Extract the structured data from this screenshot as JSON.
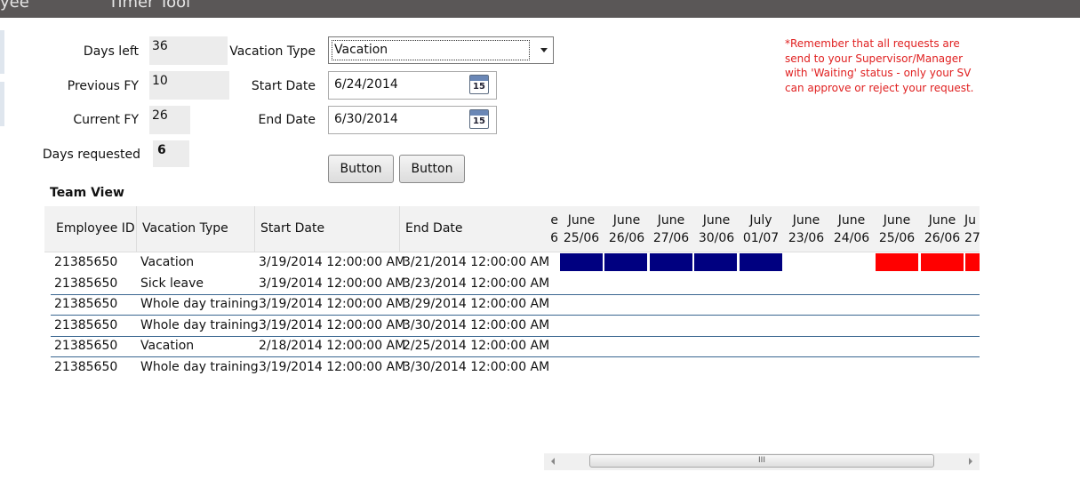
{
  "header": {
    "tab_left": "yee",
    "tab_center": "Timer Tool"
  },
  "form": {
    "days_left_label": "Days left",
    "days_left_value": "36",
    "previous_fy_label": "Previous FY",
    "previous_fy_value": "10",
    "current_fy_label": "Current FY",
    "current_fy_value": "26",
    "days_requested_label": "Days requested",
    "days_requested_value": "6",
    "vacation_type_label": "Vacation Type",
    "vacation_type_value": "Vacation",
    "start_date_label": "Start Date",
    "start_date_value": "6/24/2014",
    "end_date_label": "End Date",
    "end_date_value": "6/30/2014",
    "calendar_day": "15",
    "button1_label": "Button",
    "button2_label": "Button"
  },
  "note": "*Remember that all requests are send to your Supervisor/Manager with 'Waiting' status - only your SV can approve or reject your request.",
  "team_view": {
    "title": "Team View",
    "columns": [
      "Employee ID",
      "Vacation Type",
      "Start Date",
      "End Date"
    ],
    "day_columns": [
      {
        "month": "e",
        "day": "6"
      },
      {
        "month": "June",
        "day": "25/06"
      },
      {
        "month": "June",
        "day": "26/06"
      },
      {
        "month": "June",
        "day": "27/06"
      },
      {
        "month": "June",
        "day": "30/06"
      },
      {
        "month": "July",
        "day": "01/07"
      },
      {
        "month": "June",
        "day": "23/06"
      },
      {
        "month": "June",
        "day": "24/06"
      },
      {
        "month": "June",
        "day": "25/06"
      },
      {
        "month": "June",
        "day": "26/06"
      },
      {
        "month": "Ju",
        "day": "27"
      }
    ],
    "rows": [
      {
        "id": "21385650",
        "type": "Vacation",
        "start": "3/19/2014 12:00:00 AM",
        "end": "3/21/2014 12:00:00 AM"
      },
      {
        "id": "21385650",
        "type": "Sick leave",
        "start": "3/19/2014 12:00:00 AM",
        "end": "3/23/2014 12:00:00 AM"
      },
      {
        "id": "21385650",
        "type": "Whole day training",
        "start": "3/19/2014 12:00:00 AM",
        "end": "3/29/2014 12:00:00 AM"
      },
      {
        "id": "21385650",
        "type": "Whole day training",
        "start": "3/19/2014 12:00:00 AM",
        "end": "3/30/2014 12:00:00 AM"
      },
      {
        "id": "21385650",
        "type": "Vacation",
        "start": "2/18/2014 12:00:00 AM",
        "end": "2/25/2014 12:00:00 AM"
      },
      {
        "id": "21385650",
        "type": "Whole day training",
        "start": "3/19/2014 12:00:00 AM",
        "end": "3/30/2014 12:00:00 AM"
      }
    ],
    "bar_colors": {
      "approved": "#000080",
      "waiting": "#ff0000"
    }
  },
  "scrollbar": {
    "grip": "III"
  }
}
